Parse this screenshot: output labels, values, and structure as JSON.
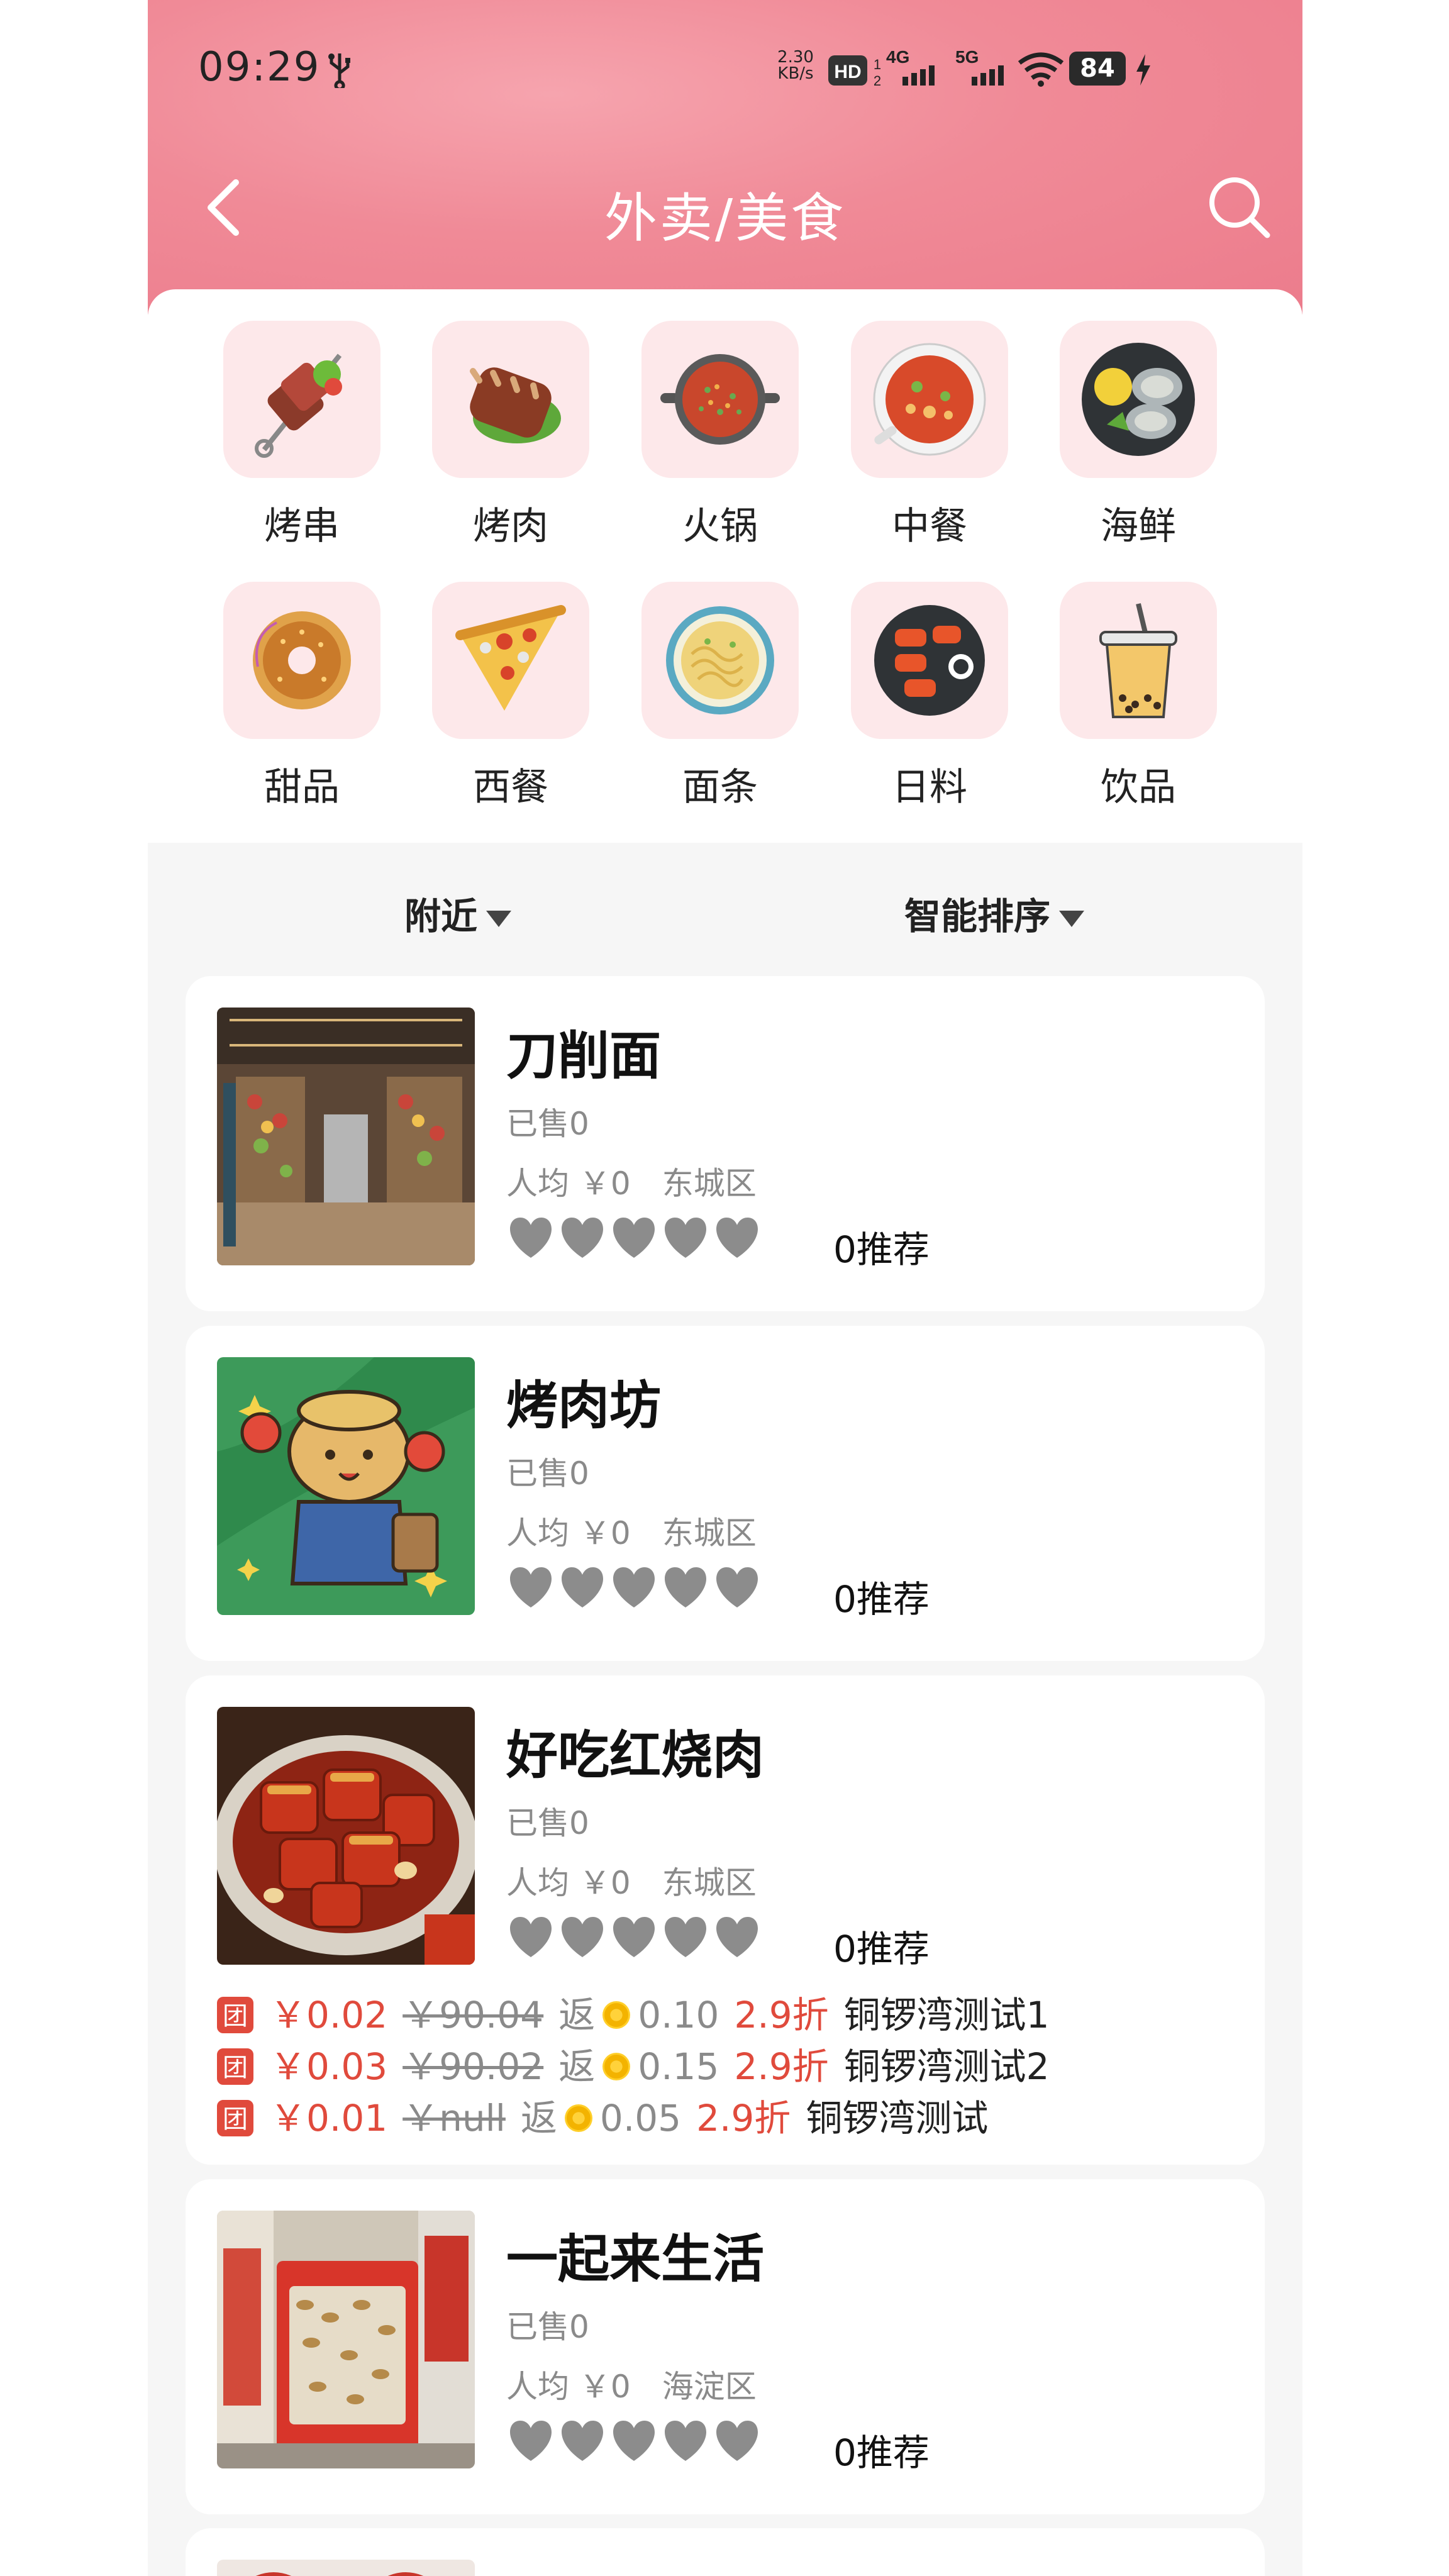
{
  "status_bar": {
    "time": "09:29",
    "net_speed_value": "2.30",
    "net_speed_unit": "KB/s",
    "hd_label": "HD",
    "sim1_network": "4G",
    "sim2_network": "5G",
    "battery": "84"
  },
  "nav": {
    "title": "外卖/美食"
  },
  "categories": [
    {
      "label": "烤串",
      "icon": "skewer-icon"
    },
    {
      "label": "烤肉",
      "icon": "ribs-icon"
    },
    {
      "label": "火锅",
      "icon": "hotpot-icon"
    },
    {
      "label": "中餐",
      "icon": "soup-bowl-icon"
    },
    {
      "label": "海鲜",
      "icon": "oyster-icon"
    },
    {
      "label": "甜品",
      "icon": "donut-icon"
    },
    {
      "label": "西餐",
      "icon": "pizza-icon"
    },
    {
      "label": "面条",
      "icon": "noodle-bowl-icon"
    },
    {
      "label": "日料",
      "icon": "sushi-icon"
    },
    {
      "label": "饮品",
      "icon": "bubble-tea-icon"
    }
  ],
  "filters": {
    "nearby": "附近",
    "sort": "智能排序"
  },
  "shops": [
    {
      "name": "刀削面",
      "sold": "已售0",
      "avg_price": "人均 ￥0",
      "district": "东城区",
      "rating": 0,
      "recommend": "0推荐",
      "image": "supermarket-interior-photo",
      "deals": []
    },
    {
      "name": "烤肉坊",
      "sold": "已售0",
      "avg_price": "人均 ￥0",
      "district": "东城区",
      "rating": 0,
      "recommend": "0推荐",
      "image": "cartoon-bear-farmer-image",
      "deals": []
    },
    {
      "name": "好吃红烧肉",
      "sold": "已售0",
      "avg_price": "人均 ￥0",
      "district": "东城区",
      "rating": 0,
      "recommend": "0推荐",
      "image": "braised-pork-photo",
      "deals": [
        {
          "badge": "团",
          "price": "￥0.02",
          "original": "￥90.04",
          "rebate_label": "返",
          "rebate": "0.10",
          "discount": "2.9折",
          "name": "铜锣湾测试1"
        },
        {
          "badge": "团",
          "price": "￥0.03",
          "original": "￥90.02",
          "rebate_label": "返",
          "rebate": "0.15",
          "discount": "2.9折",
          "name": "铜锣湾测试2"
        },
        {
          "badge": "团",
          "price": "￥0.01",
          "original": "￥null",
          "rebate_label": "返",
          "rebate": "0.05",
          "discount": "2.9折",
          "name": "铜锣湾测试"
        }
      ]
    },
    {
      "name": "一起来生活",
      "sold": "已售0",
      "avg_price": "人均 ￥0",
      "district": "海淀区",
      "rating": 0,
      "recommend": "0推荐",
      "image": "peanut-snack-package-photo",
      "deals": []
    }
  ],
  "colors": {
    "header_pink": "#f08a97",
    "tile_pink": "#fde8ea",
    "price_red": "#e04a3c",
    "muted_gray": "#8a8a8a",
    "heart_gray": "#8c8c8c"
  }
}
